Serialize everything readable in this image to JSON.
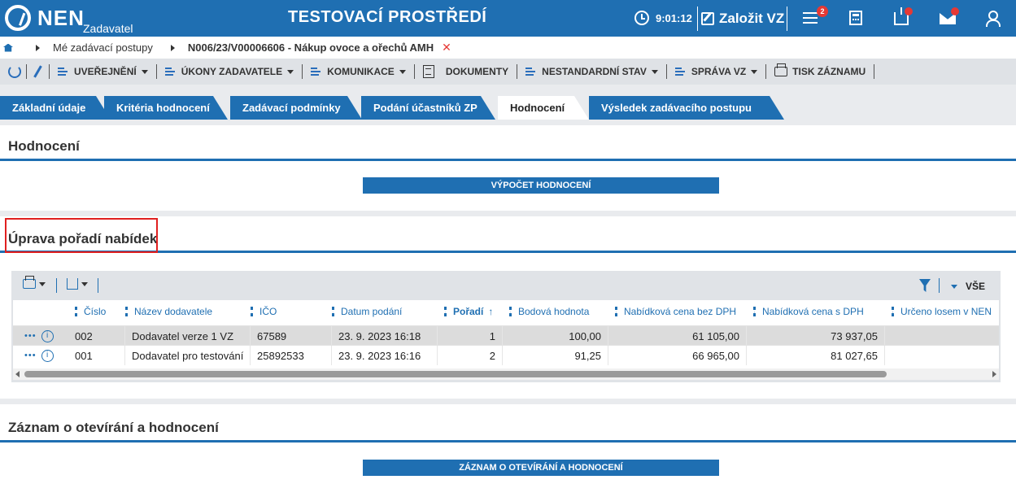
{
  "header": {
    "brand": "NEN",
    "brand_sub": "Zadavatel",
    "env_title": "TESTOVACÍ PROSTŘEDÍ",
    "time": "9:01:12",
    "create_label": "Založit VZ",
    "notif_count": "2"
  },
  "breadcrumb": {
    "item1": "Mé zadávací postupy",
    "current": "N006/23/V00006606 - Nákup ovoce a ořechů AMH",
    "close": "✕"
  },
  "toolbar": {
    "uverejneni": "UVEŘEJNĚNÍ",
    "ukony": "ÚKONY ZADAVATELE",
    "komunikace": "KOMUNIKACE",
    "dokumenty": "DOKUMENTY",
    "nestandardni": "NESTANDARDNÍ STAV",
    "sprava": "SPRÁVA VZ",
    "tisk": "TISK ZÁZNAMU"
  },
  "tabs": [
    {
      "label": "Základní údaje"
    },
    {
      "label": "Kritéria hodnocení"
    },
    {
      "label": "Zadávací podmínky"
    },
    {
      "label": "Podání účastníků ZP"
    },
    {
      "label": "Hodnocení"
    },
    {
      "label": "Výsledek zadávacího postupu"
    }
  ],
  "section_hodnoceni": {
    "title": "Hodnocení",
    "button": "VÝPOČET HODNOCENÍ"
  },
  "section_uprava": {
    "title": "Úprava pořadí nabídek",
    "filter_all": "VŠE",
    "columns": [
      "Číslo",
      "Název dodavatele",
      "IČO",
      "Datum podání",
      "Pořadí",
      "Bodová hodnota",
      "Nabídková cena bez DPH",
      "Nabídková cena s DPH",
      "Určeno losem v NEN"
    ],
    "rows": [
      {
        "cislo": "002",
        "nazev": "Dodavatel verze 1 VZ",
        "ico": "67589",
        "datum": "23. 9. 2023 16:18",
        "poradi": "1",
        "body": "100,00",
        "bez_dph": "61 105,00",
        "s_dph": "73 937,05",
        "los": ""
      },
      {
        "cislo": "001",
        "nazev": "Dodavatel pro testování",
        "ico": "25892533",
        "datum": "23. 9. 2023 16:16",
        "poradi": "2",
        "body": "91,25",
        "bez_dph": "66 965,00",
        "s_dph": "81 027,65",
        "los": ""
      }
    ]
  },
  "section_zaznam": {
    "title": "Záznam o otevírání a hodnocení",
    "button": "ZÁZNAM O OTEVÍRÁNÍ A HODNOCENÍ"
  },
  "colors": {
    "brand_blue": "#1f6fb2",
    "alert_red": "#e53935"
  }
}
